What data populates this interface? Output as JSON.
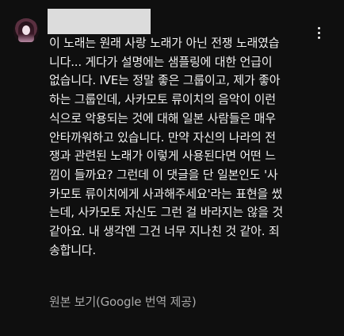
{
  "comment": {
    "text": " 이 노래는 원래 사랑 노래가 아닌 전쟁 노래였습니다... 게다가 설명에는 샘플링에 대한 언급이 없습니다. IVE는 정말 좋은 그룹이고, 제가 좋아하는 그룹인데, 사카모토 류이치의 음악이 이런 식으로 악용되는 것에 대해 일본 사람들은 매우 안타까워하고 있습니다. 만약 자신의 나라의 전쟁과 관련된 노래가 이렇게 사용된다면 어떤 느낌이 들까요? 그런데 이 댓글을 단 일본인도 '사카모토 류이치에게 사과해주세요'라는 표현을 썼는데, 사카모토 자신도 그런 걸 바라지는 않을 것 같아요. 내 생각엔 그건 너무 지나친 것 같아. 죄송합니다.",
    "lines": [
      " 이 노래는 원래 사랑 노래가 아닌 전쟁 노래였습",
      "니다... 게다가 설명에는 샘플링에 대한 언급이",
      "없습니다. IVE는 정말 좋은 그룹이고, 제가 좋아",
      "하는 그룹인데, 사카모토 류이치의 음악이 이런",
      "식으로 악용되는 것에 대해 일본 사람들은 매우",
      "안타까워하고 있습니다. 만약 자신의 나라의 전",
      "쟁과 관련된 노래가 이렇게 사용된다면 어떤 느",
      "낌이 들까요? 그런데 이 댓글을 단 일본인도 '사",
      "카모토 류이치에게 사과해주세요'라는 표현을 썼",
      "는데, 사카모토 자신도 그런 걸 바라지는 않을 것",
      "같아요. 내 생각엔 그건 너무 지나친 것 같아. 죄",
      "송합니다."
    ],
    "translate_link": "원본 보기(Google 번역 제공)"
  },
  "icons": {
    "avatar": "user-avatar",
    "more": "more-vertical-icon"
  },
  "colors": {
    "background": "#0f0f0f",
    "text": "#f1f1f1",
    "secondary_text": "#aaaaaa",
    "redaction": "#dcdcdc"
  }
}
